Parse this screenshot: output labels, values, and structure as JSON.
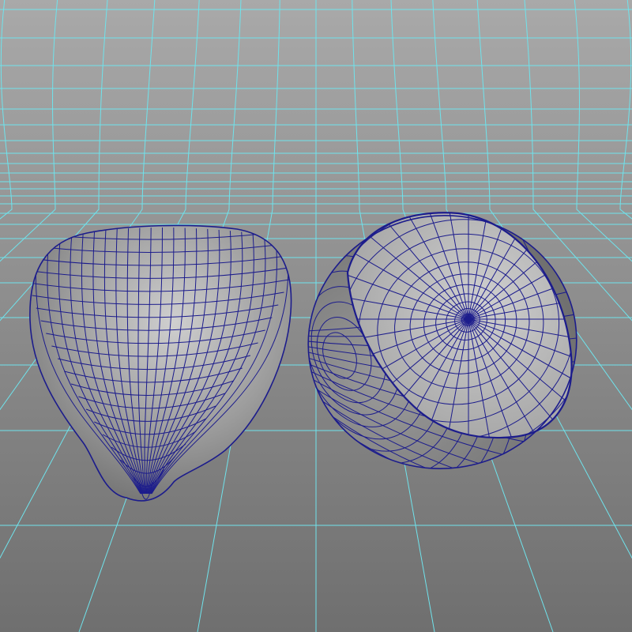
{
  "viewport": {
    "projection": "perspective",
    "display_mode": "wireframe-on-shaded"
  },
  "colors": {
    "background_top": "#a9a9a9",
    "background_bottom": "#6f6f6f",
    "grid_line": "#6fe3ec",
    "wire": "#1c1c8c",
    "surface_light": "#cfcfcf",
    "surface_mid": "#9c9c9c",
    "surface_dark": "#6a6a6a"
  },
  "scene": {
    "objects": [
      {
        "name": "fruit-half-skin",
        "kind": "half-shell-with-stem-tip"
      },
      {
        "name": "fruit-half-cut",
        "kind": "half-with-flat-cut-face"
      }
    ]
  }
}
